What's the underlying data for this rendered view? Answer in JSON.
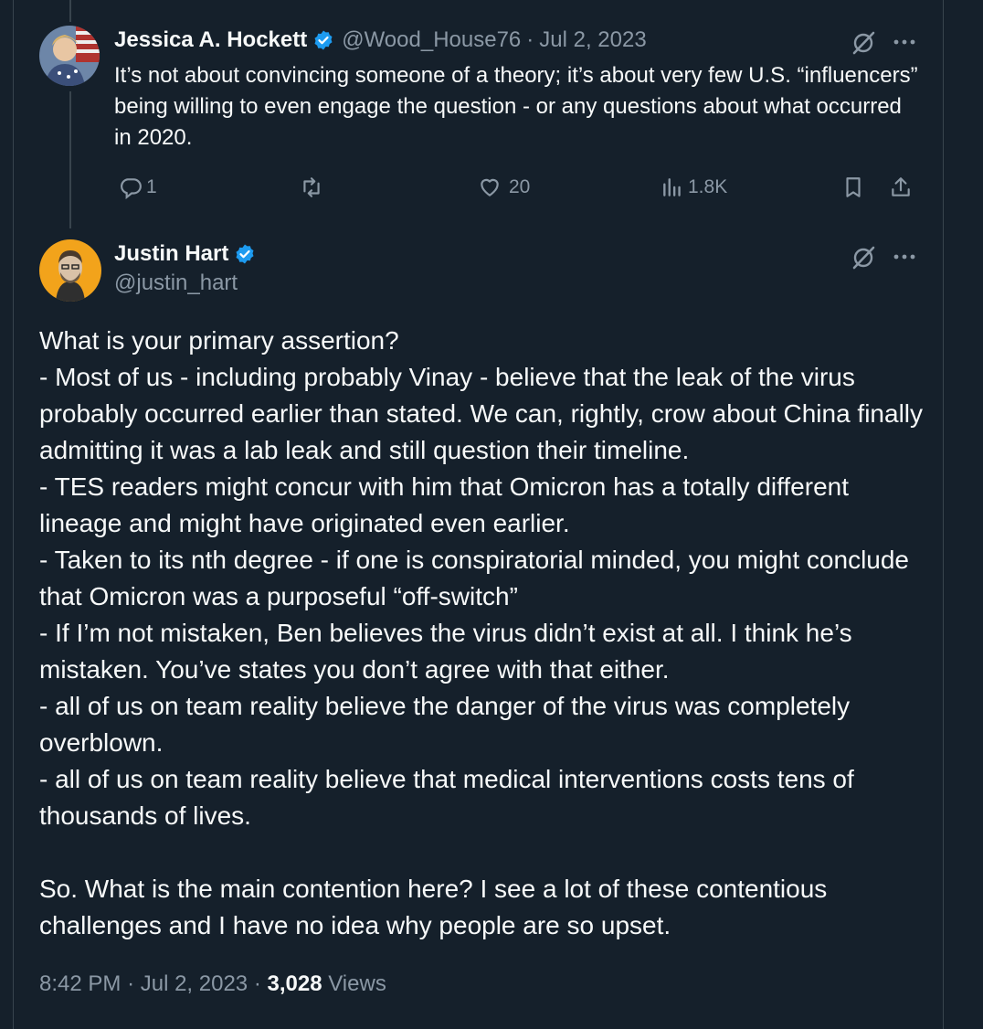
{
  "reply": {
    "name": "Jessica A. Hockett",
    "handle": "@Wood_House76",
    "separator": "·",
    "date": "Jul 2, 2023",
    "text": "It’s not about convincing someone of a theory; it’s about very few U.S. “influencers” being willing to even engage the question - or any questions about what occurred in 2020.",
    "stats": {
      "replies": "1",
      "retweets": "",
      "likes": "20",
      "views": "1.8K"
    }
  },
  "main": {
    "name": "Justin Hart",
    "handle": "@justin_hart",
    "text": "What is your primary assertion?\n- Most of us - including probably Vinay - believe that the leak of the virus probably occurred earlier than stated. We can, rightly, crow about China finally admitting it was a lab leak and still question their timeline.\n- TES readers might concur with him that Omicron has a totally different lineage and might have originated even earlier.\n- Taken to its nth degree - if one is conspiratorial minded, you might conclude that Omicron was a purposeful “off-switch”\n- If I’m not mistaken, Ben believes the virus didn’t exist at all. I think he’s mistaken. You’ve states you don’t agree with that either.\n- all of us on team reality believe the danger of the virus was completely overblown.\n- all of us on team reality believe that medical interventions costs tens of thousands of lives.\n\nSo. What is the main contention here? I see a lot of these contentious challenges and I have no idea why people are so upset.",
    "time": "8:42 PM",
    "separator": "·",
    "date": "Jul 2, 2023",
    "views_count": "3,028",
    "views_label": "Views"
  },
  "icons": {
    "verified": "verified-badge-icon",
    "grok": "grok-icon",
    "more": "more-icon",
    "reply": "reply-icon",
    "retweet": "retweet-icon",
    "like": "heart-icon",
    "views": "views-chart-icon",
    "bookmark": "bookmark-icon",
    "share": "share-icon"
  },
  "colors": {
    "background": "#15202b",
    "text": "#f7f9f9",
    "secondary": "#8b98a5",
    "verified": "#1d9bf0",
    "border": "#38444d"
  }
}
